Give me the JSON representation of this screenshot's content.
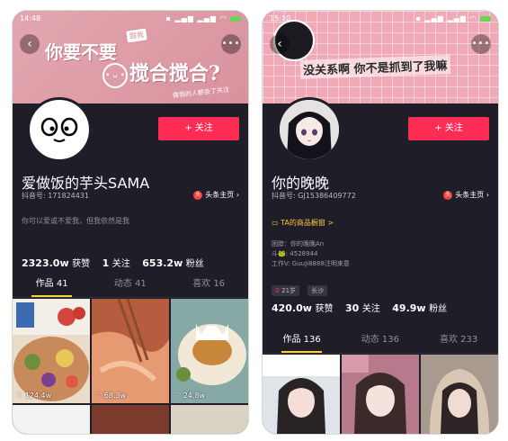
{
  "screen1": {
    "status": {
      "time": "14:48"
    },
    "banner": {
      "text_main": "你要不要",
      "tag": "跟我",
      "text_big": "搅合搅合?",
      "small_text": "做我的人都会了关注"
    },
    "follow_label": "+ 关注",
    "nickname": "爱做饭的芋头SAMA",
    "uid": "抖音号: 171824431",
    "toutiao_label": "头条主页",
    "bio": "你可以爱或不爱我，但我依然是我",
    "stats": {
      "likes_num": "2323.0w",
      "likes_label": "获赞",
      "following_num": "1",
      "following_label": "关注",
      "fans_num": "653.2w",
      "fans_label": "粉丝"
    },
    "tabs": [
      "作品 41",
      "动态 41",
      "喜欢 16"
    ],
    "posts": [
      {
        "likes": "124.4w",
        "colors": [
          "#c98a5b",
          "#6b8f3b",
          "#e9c85a"
        ]
      },
      {
        "likes": "68.3w",
        "colors": [
          "#d07a57",
          "#e59a72",
          "#8a4c2b"
        ]
      },
      {
        "likes": "24.8w",
        "colors": [
          "#7aa7a8",
          "#c9873b",
          "#f2e8d8"
        ]
      }
    ]
  },
  "screen2": {
    "status": {
      "time": "15:10"
    },
    "banner": {
      "text": "没关系啊 你不是抓到了我嘛"
    },
    "follow_label": "+ 关注",
    "nickname": "你的晚晚",
    "uid": "抖音号: GJ15386409772",
    "toutiao_label": "头条主页",
    "shop_label": "TA的商品橱窗 >",
    "bio_lines": [
      "困脖：你的晚晚An",
      "斗🐸: 4528944",
      "工作V: GuuJi8888注明来意"
    ],
    "tags": [
      "21岁",
      "长沙"
    ],
    "stats": {
      "likes_num": "420.0w",
      "likes_label": "获赞",
      "following_num": "30",
      "following_label": "关注",
      "fans_num": "49.9w",
      "fans_label": "粉丝"
    },
    "tabs": [
      "作品 136",
      "动态 136",
      "喜欢 233"
    ],
    "posts": [
      {
        "colors": [
          "#cfd8e2",
          "#2a2326"
        ]
      },
      {
        "colors": [
          "#c48ba0",
          "#3b2a2a"
        ]
      },
      {
        "colors": [
          "#b9a99b",
          "#2d2425"
        ]
      }
    ]
  }
}
